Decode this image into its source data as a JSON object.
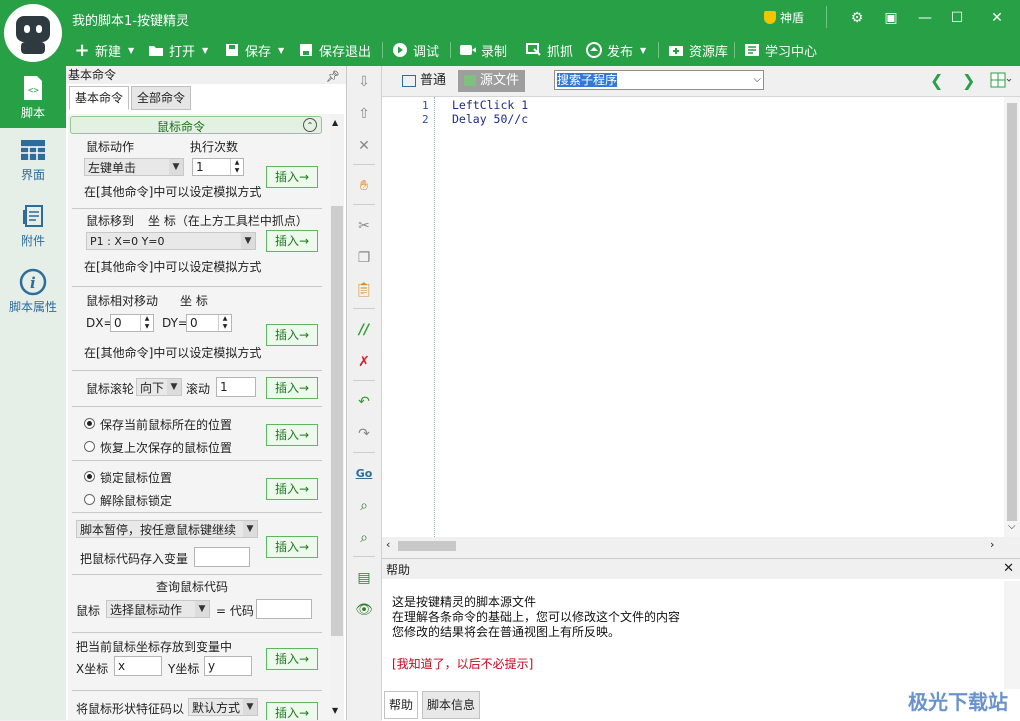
{
  "window": {
    "title": "我的脚本1-按键精灵",
    "account": "神盾",
    "controls": [
      "⚙",
      "▣",
      "—",
      "☐",
      "✕"
    ]
  },
  "toolbar": [
    {
      "label": "新建",
      "icon": "plus-icon",
      "dropdown": true
    },
    {
      "label": "打开",
      "icon": "folder-icon",
      "dropdown": true
    },
    {
      "label": "保存",
      "icon": "save-icon",
      "dropdown": true
    },
    {
      "label": "保存退出",
      "icon": "save-exit-icon"
    },
    {
      "label": "调试",
      "icon": "play-icon"
    },
    {
      "label": "录制",
      "icon": "camera-icon"
    },
    {
      "label": "抓抓",
      "icon": "grab-icon"
    },
    {
      "label": "发布",
      "icon": "publish-icon",
      "dropdown": true
    },
    {
      "label": "资源库",
      "icon": "resource-icon"
    },
    {
      "label": "学习中心",
      "icon": "learn-icon"
    }
  ],
  "leftnav": [
    {
      "label": "脚本",
      "active": true
    },
    {
      "label": "界面",
      "active": false
    },
    {
      "label": "附件",
      "active": false
    },
    {
      "label": "脚本属性",
      "active": false
    }
  ],
  "panel": {
    "title": "基本命令",
    "tabs": [
      "基本命令",
      "全部命令"
    ],
    "group_header": "鼠标命令",
    "insert_label": "插入→",
    "sec1": {
      "action_label": "鼠标动作",
      "count_label": "执行次数",
      "action_value": "左键单击",
      "count_value": "1",
      "hint": "在[其他命令]中可以设定模拟方式"
    },
    "sec2": {
      "move_label": "鼠标移到",
      "coord_label": "坐 标（在上方工具栏中抓点）",
      "point_value": "P1 : X=0 Y=0",
      "hint": "在[其他命令]中可以设定模拟方式"
    },
    "sec3": {
      "rel_label": "鼠标相对移动",
      "coord_label": "坐 标",
      "dx_label": "DX=",
      "dx_value": "0",
      "dy_label": "DY=",
      "dy_value": "0",
      "hint": "在[其他命令]中可以设定模拟方式"
    },
    "sec4": {
      "wheel_label": "鼠标滚轮",
      "dir_value": "向下",
      "scroll_label": "滚动",
      "scroll_value": "1"
    },
    "sec5": {
      "opt1": "保存当前鼠标所在的位置",
      "opt2": "恢复上次保存的鼠标位置"
    },
    "sec6": {
      "opt1": "锁定鼠标位置",
      "opt2": "解除鼠标锁定"
    },
    "sec7": {
      "pause_value": "脚本暂停，按任意鼠标键继续",
      "var_label": "把鼠标代码存入变量"
    },
    "sec8": {
      "title": "查询鼠标代码",
      "mouse_label": "鼠标",
      "select_value": "选择鼠标动作",
      "eq_label": "= 代码"
    },
    "sec9": {
      "title": "把当前鼠标坐标存放到变量中",
      "x_label": "X坐标",
      "x_value": "x",
      "y_label": "Y坐标",
      "y_value": "y"
    },
    "sec10": {
      "title": "将鼠标形状特征码以",
      "mode_value": "默认方式"
    }
  },
  "editor": {
    "tabs": [
      "普通",
      "源文件"
    ],
    "active_tab": "源文件",
    "search_placeholder": "搜索子程序",
    "lines": [
      {
        "num": "1",
        "text": "LeftClick 1"
      },
      {
        "num": "2",
        "text": "Delay 50//c"
      }
    ]
  },
  "help": {
    "title": "帮助",
    "lines": [
      "这是按键精灵的脚本源文件",
      "在理解各条命令的基础上，您可以修改这个文件的内容",
      "您修改的结果将会在普通视图上有所反映。"
    ],
    "dismiss": "[我知道了，以后不必提示]",
    "tabs": [
      "帮助",
      "脚本信息"
    ],
    "watermark": "极光下载站"
  }
}
